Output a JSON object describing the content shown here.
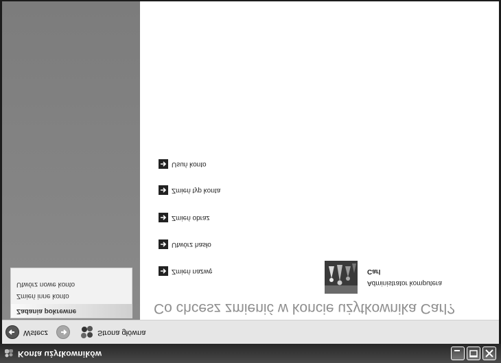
{
  "window": {
    "title": "Konta użytkowników"
  },
  "toolbar": {
    "back_label": "Wstecz",
    "home_label": "Strona główna"
  },
  "sidebar": {
    "tasks_header": "Zadania pokrewne",
    "tasks": [
      "Zmień inne konto",
      "Utwórz nowe konto"
    ]
  },
  "main": {
    "heading": "Co chcesz zmienić w koncie użytkownika Carl?",
    "actions": [
      "Zmień nazwę",
      "Utwórz hasło",
      "Zmień obraz",
      "Zmień typ konta",
      "Usuń konto"
    ],
    "user": {
      "name": "Carl",
      "role": "Administrator komputera"
    }
  },
  "icons": {
    "window": "user-accounts-icon",
    "back": "back-arrow-icon",
    "forward": "forward-arrow-icon",
    "home": "home-icon",
    "action": "right-arrow-icon",
    "minimize": "minimize-icon",
    "maximize": "maximize-icon",
    "close": "close-icon"
  }
}
